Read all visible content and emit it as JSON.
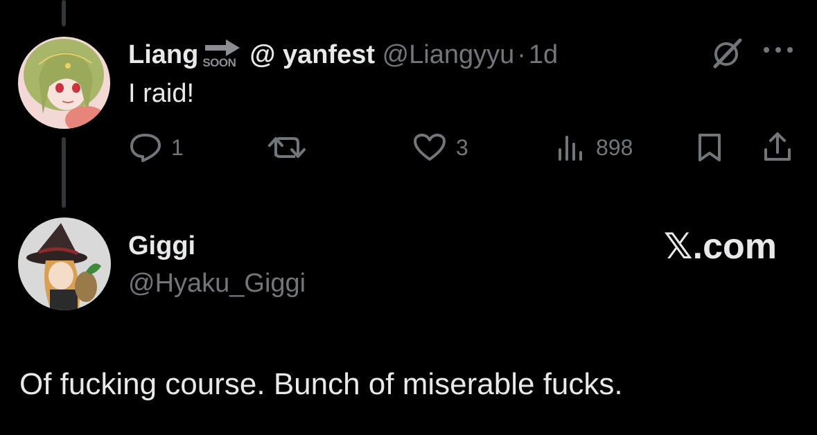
{
  "tweet": {
    "author_name": "Liang",
    "badge_text": "SOON",
    "name_suffix": "@ yanfest",
    "handle": "@Liangyyu",
    "separator": "·",
    "time": "1d",
    "text": "I raid!",
    "actions": {
      "replies": "1",
      "retweets": "",
      "likes": "3",
      "views": "898"
    },
    "icons": [
      "grok-icon",
      "more-icon",
      "reply-icon",
      "retweet-icon",
      "like-icon",
      "views-icon",
      "bookmark-icon",
      "share-icon"
    ]
  },
  "quote": {
    "author_name": "Giggi",
    "handle": "@Hyaku_Giggi",
    "watermark": "𝕏.com",
    "text": "Of fucking course. Bunch of miserable fucks."
  },
  "colors": {
    "background": "#000000",
    "text": "#e7e9ea",
    "muted": "#71767b",
    "thread_line": "#333639"
  }
}
